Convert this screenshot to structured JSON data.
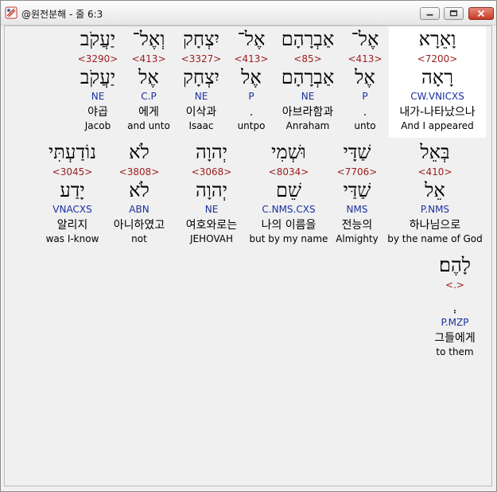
{
  "window": {
    "title": "@원전분해 - 줄 6:3",
    "icon": "app-icon",
    "buttons": {
      "minimize": "minimize-icon",
      "maximize": "maximize-icon",
      "close": "close-icon"
    }
  },
  "rows": [
    [
      {
        "heb": "וָאֵרָא",
        "strong": "<7200>",
        "lemma": "רָאָה",
        "morph": "CW.VNICXS",
        "korean": "내가-나타났으나",
        "english": "And I appeared",
        "selected": true
      },
      {
        "heb": "אֶל־",
        "strong": "<413>",
        "lemma": "אֶל",
        "morph": "P",
        "korean": ".",
        "english": "unto"
      },
      {
        "heb": "אַבְרָהָם",
        "strong": "<85>",
        "lemma": "אַבְרָהָם",
        "morph": "NE",
        "korean": "아브라함과",
        "english": "Anraham"
      },
      {
        "heb": "אֶל־",
        "strong": "<413>",
        "lemma": "אֶל",
        "morph": "P",
        "korean": ".",
        "english": "untpo"
      },
      {
        "heb": "יִצְחָק",
        "strong": "<3327>",
        "lemma": "יִצְחָק",
        "morph": "NE",
        "korean": "이삭과",
        "english": "Isaac"
      },
      {
        "heb": "וְאֶל־",
        "strong": "<413>",
        "lemma": "אֶל",
        "morph": "C.P",
        "korean": "에게",
        "english": "and unto"
      },
      {
        "heb": "יַעֲקֹב",
        "strong": "<3290>",
        "lemma": "יַעֲקֹב",
        "morph": "NE",
        "korean": "야곱",
        "english": "Jacob"
      }
    ],
    [
      {
        "heb": "בְּאֵל",
        "strong": "<410>",
        "lemma": "אֵל",
        "morph": "P.NMS",
        "korean": "하나님으로",
        "english": "by the name of God"
      },
      {
        "heb": "שַׁדָּי",
        "strong": "<7706>",
        "lemma": "שַׁדַּי",
        "morph": "NMS",
        "korean": "전능의",
        "english": "Almighty"
      },
      {
        "heb": "וּשְׁמִי",
        "strong": "<8034>",
        "lemma": "שֵׁם",
        "morph": "C.NMS.CXS",
        "korean": "나의 이름을",
        "english": "but by my name"
      },
      {
        "heb": "יְהוָה",
        "strong": "<3068>",
        "lemma": "יְהוָה",
        "morph": "NE",
        "korean": "여호와로는",
        "english": "JEHOVAH"
      },
      {
        "heb": "לֹא",
        "strong": "<3808>",
        "lemma": "לֹא",
        "morph": "ABN",
        "korean": "아니하였고",
        "english": "not"
      },
      {
        "heb": "נוֹדַעְתִּי",
        "strong": "<3045>",
        "lemma": "יָדַע",
        "morph": "VNACXS",
        "korean": "알리지",
        "english": "was I-know"
      }
    ],
    [
      {
        "heb": "לָהֶם׃",
        "strong": "<.>",
        "lemma": "ְ",
        "morph": "P.MZP",
        "korean": "그들에게",
        "english": "to them"
      }
    ]
  ]
}
